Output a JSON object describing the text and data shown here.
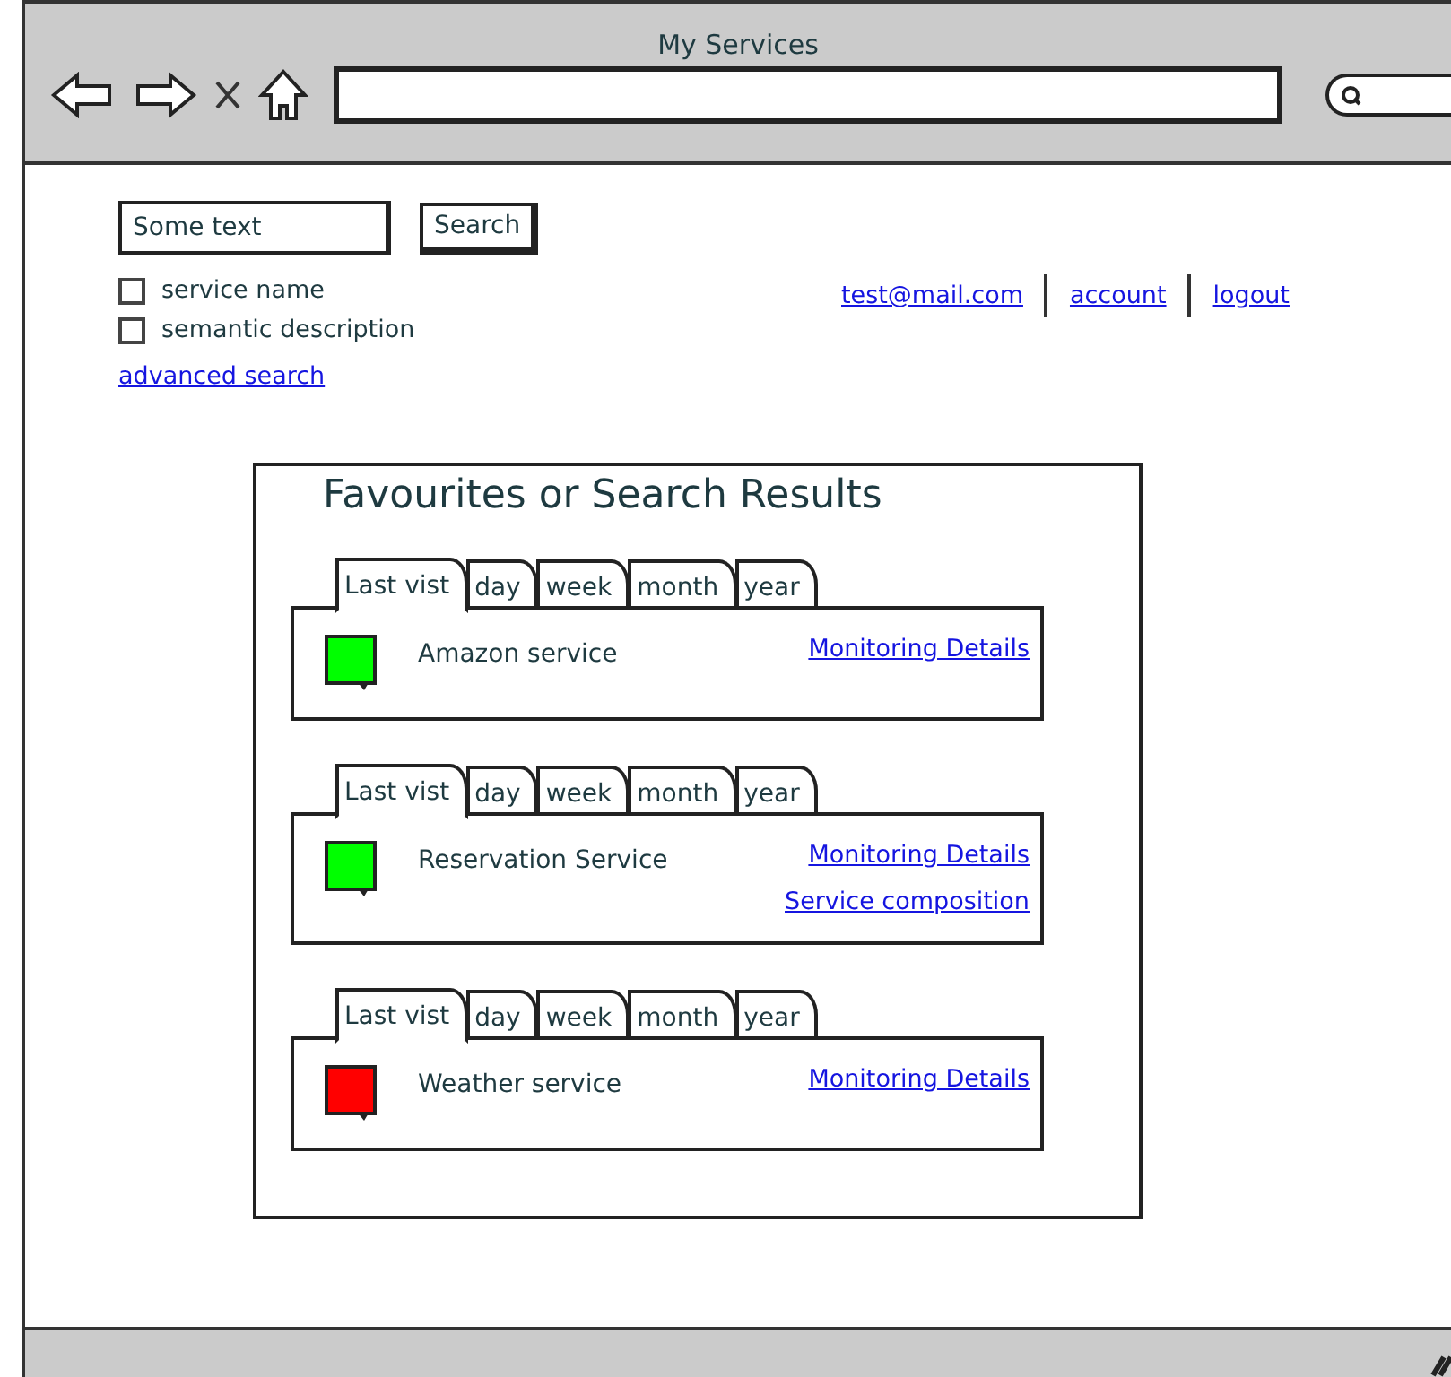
{
  "window": {
    "title": "My Services"
  },
  "search": {
    "value": "Some text",
    "button": "Search",
    "options": [
      {
        "label": "service name",
        "checked": false
      },
      {
        "label": "semantic description",
        "checked": false
      }
    ],
    "advanced_link": "advanced search"
  },
  "user_links": [
    "test@mail.com",
    "account",
    "logout"
  ],
  "results": {
    "title": "Favourites or Search Results",
    "items": [
      {
        "name": "Amazon service",
        "color": "#00ff00",
        "tabs": [
          {
            "label": "Last vist",
            "selected": true
          },
          {
            "label": "day",
            "selected": false
          },
          {
            "label": "week",
            "selected": false
          },
          {
            "label": "month",
            "selected": false
          },
          {
            "label": "year",
            "selected": false
          }
        ],
        "links": [
          "Monitoring Details"
        ]
      },
      {
        "name": "Reservation Service",
        "color": "#00ff00",
        "tabs": [
          {
            "label": "Last vist",
            "selected": true
          },
          {
            "label": "day",
            "selected": false
          },
          {
            "label": "week",
            "selected": false
          },
          {
            "label": "month",
            "selected": false
          },
          {
            "label": "year",
            "selected": false
          }
        ],
        "links": [
          "Monitoring Details",
          "Service composition"
        ]
      },
      {
        "name": "Weather service",
        "color": "#ff0000",
        "tabs": [
          {
            "label": "Last vist",
            "selected": true
          },
          {
            "label": "day",
            "selected": false
          },
          {
            "label": "week",
            "selected": false
          },
          {
            "label": "month",
            "selected": false
          },
          {
            "label": "year",
            "selected": false
          }
        ],
        "links": [
          "Monitoring Details"
        ]
      }
    ]
  }
}
